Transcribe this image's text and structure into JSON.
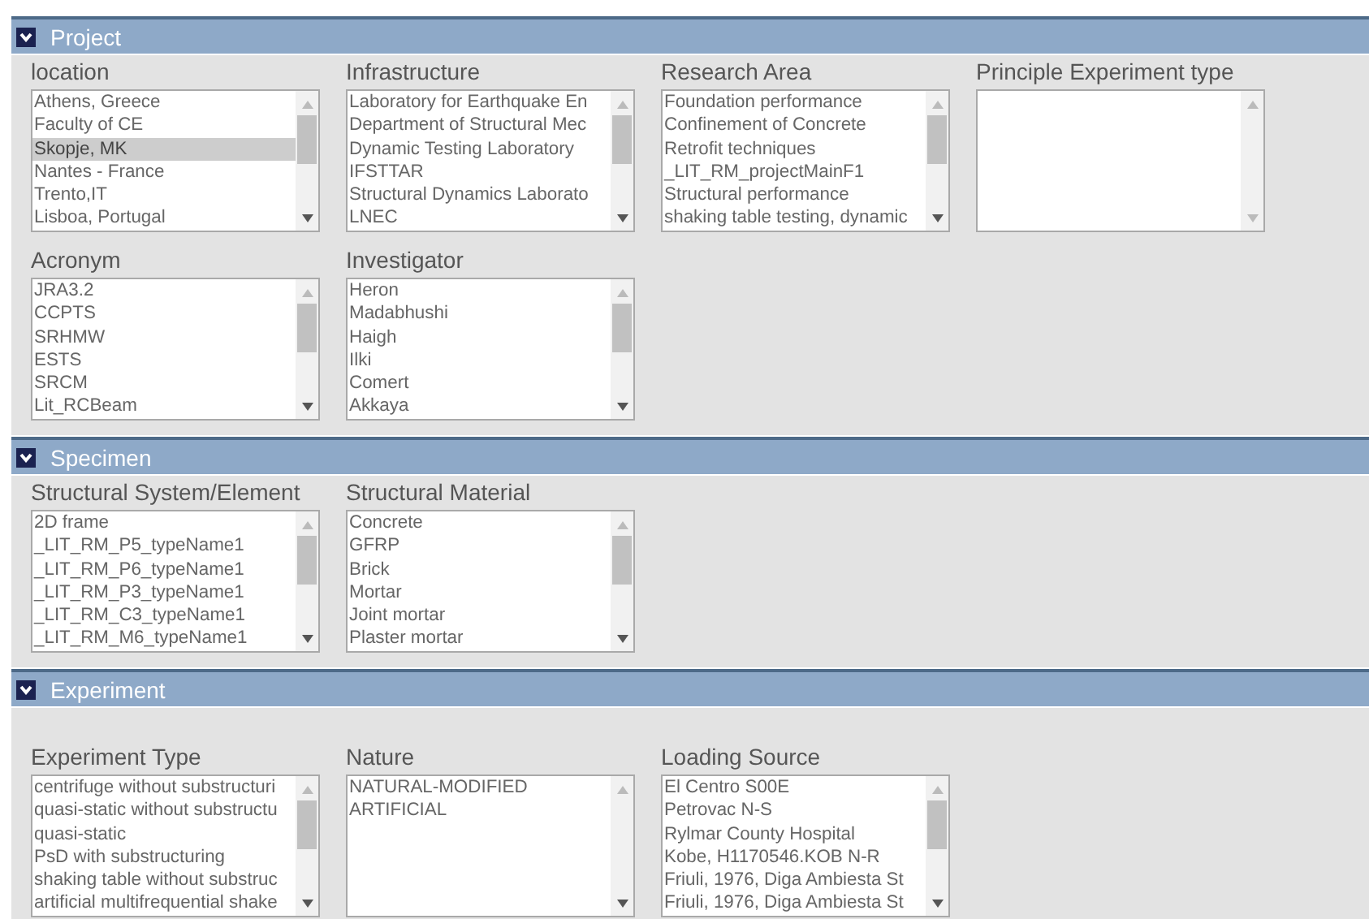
{
  "sections": [
    {
      "title": "Project",
      "expanded": true,
      "fields": [
        {
          "label": "location",
          "items": [
            {
              "text": "Athens, Greece",
              "selected": false
            },
            {
              "text": "Faculty of CE",
              "selected": false
            },
            {
              "text": "Skopje, MK",
              "selected": true
            },
            {
              "text": "Nantes - France",
              "selected": false
            },
            {
              "text": "Trento,IT",
              "selected": false
            },
            {
              "text": "Lisboa, Portugal",
              "selected": false
            }
          ]
        },
        {
          "label": "Infrastructure",
          "items": [
            {
              "text": "Laboratory for Earthquake En",
              "selected": false
            },
            {
              "text": "Department of Structural Mec",
              "selected": false
            },
            {
              "text": "Dynamic Testing Laboratory",
              "selected": false
            },
            {
              "text": "IFSTTAR",
              "selected": false
            },
            {
              "text": "Structural Dynamics Laborato",
              "selected": false
            },
            {
              "text": "LNEC",
              "selected": false
            }
          ]
        },
        {
          "label": "Research Area",
          "items": [
            {
              "text": "Foundation performance",
              "selected": false
            },
            {
              "text": "Confinement of Concrete",
              "selected": false
            },
            {
              "text": "Retrofit techniques",
              "selected": false
            },
            {
              "text": "_LIT_RM_projectMainF1",
              "selected": false
            },
            {
              "text": "Structural performance",
              "selected": false
            },
            {
              "text": "shaking table testing, dynamic",
              "selected": false
            }
          ]
        },
        {
          "label": "Principle Experiment type"
        },
        {
          "label": "Acronym",
          "items": [
            {
              "text": "JRA3.2",
              "selected": false
            },
            {
              "text": "CCPTS",
              "selected": false
            },
            {
              "text": "SRHMW",
              "selected": false
            },
            {
              "text": "ESTS",
              "selected": false
            },
            {
              "text": "SRCM",
              "selected": false
            },
            {
              "text": "Lit_RCBeam",
              "selected": false
            }
          ]
        },
        {
          "label": "Investigator",
          "items": [
            {
              "text": "Heron",
              "selected": false
            },
            {
              "text": "Madabhushi",
              "selected": false
            },
            {
              "text": "Haigh",
              "selected": false
            },
            {
              "text": "Ilki",
              "selected": false
            },
            {
              "text": "Comert",
              "selected": false
            },
            {
              "text": "Akkaya",
              "selected": false
            }
          ]
        }
      ]
    },
    {
      "title": "Specimen",
      "expanded": true,
      "fields": [
        {
          "label": "Structural System/Element",
          "items": [
            {
              "text": "2D frame",
              "selected": false
            },
            {
              "text": "_LIT_RM_P5_typeName1",
              "selected": false
            },
            {
              "text": "_LIT_RM_P6_typeName1",
              "selected": false
            },
            {
              "text": "_LIT_RM_P3_typeName1",
              "selected": false
            },
            {
              "text": "_LIT_RM_C3_typeName1",
              "selected": false
            },
            {
              "text": "_LIT_RM_M6_typeName1",
              "selected": false
            }
          ]
        },
        {
          "label": "Structural Material",
          "items": [
            {
              "text": "Concrete",
              "selected": false
            },
            {
              "text": "GFRP",
              "selected": false
            },
            {
              "text": "Brick",
              "selected": false
            },
            {
              "text": "Mortar",
              "selected": false
            },
            {
              "text": "Joint mortar",
              "selected": false
            },
            {
              "text": "Plaster mortar",
              "selected": false
            }
          ]
        }
      ]
    },
    {
      "title": "Experiment",
      "expanded": true,
      "fields": [
        {
          "label": "Experiment Type",
          "items": [
            {
              "text": "centrifuge without substructuri",
              "selected": false
            },
            {
              "text": "quasi-static without substructu",
              "selected": false
            },
            {
              "text": "quasi-static",
              "selected": false
            },
            {
              "text": "PsD with substructuring",
              "selected": false
            },
            {
              "text": "shaking table without substruc",
              "selected": false
            },
            {
              "text": "artificial multifrequential shake",
              "selected": false
            }
          ]
        },
        {
          "label": "Nature",
          "items": [
            {
              "text": "NATURAL-MODIFIED",
              "selected": false
            },
            {
              "text": "ARTIFICIAL",
              "selected": false
            }
          ]
        },
        {
          "label": "Loading Source",
          "items": [
            {
              "text": "El Centro S00E",
              "selected": false
            },
            {
              "text": "Petrovac N-S",
              "selected": false
            },
            {
              "text": "Rylmar County Hospital",
              "selected": false
            },
            {
              "text": "Kobe, H1170546.KOB N-R",
              "selected": false
            },
            {
              "text": "Friuli, 1976, Diga Ambiesta St",
              "selected": false
            },
            {
              "text": "Friuli, 1976, Diga Ambiesta St",
              "selected": false
            }
          ]
        }
      ]
    }
  ]
}
